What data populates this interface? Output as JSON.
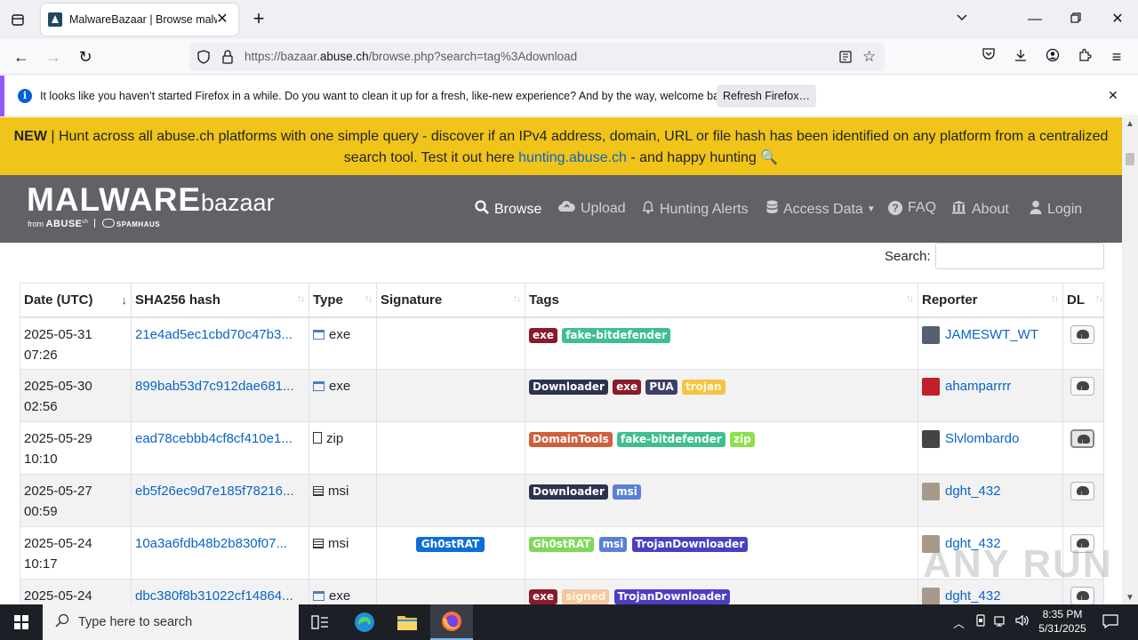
{
  "browser": {
    "tab_title": "MalwareBazaar | Browse malwa",
    "url_prefix": "https://bazaar.",
    "url_domain": "abuse.ch",
    "url_path": "/browse.php?search=tag%3Adownload"
  },
  "notification": {
    "message": "It looks like you haven’t started Firefox in a while. Do you want to clean it up for a fresh, like-new experience? And by the way, welcome back!",
    "button": "Refresh Firefox…"
  },
  "banner": {
    "new": "NEW",
    "text_1": " | Hunt across all abuse.ch platforms with one simple query - discover if an IPv4 address, domain, URL or file hash has been identified on any platform from a centralized search tool. Test it out here ",
    "link": "hunting.abuse.ch",
    "text_2": " - and happy hunting 🔍"
  },
  "site": {
    "logo_main": "MALWARE",
    "logo_sub": "bazaar",
    "logo_from": "from",
    "logo_abuse": "ABUSE",
    "logo_ch": "ch",
    "logo_spamhaus": "SPAMHAUS",
    "menu": {
      "browse": "Browse",
      "upload": "Upload",
      "hunting": "Hunting Alerts",
      "access": "Access Data",
      "faq": "FAQ",
      "about": "About",
      "login": "Login"
    },
    "search_label": "Search:"
  },
  "table": {
    "headers": {
      "date": "Date (UTC)",
      "hash": "SHA256 hash",
      "type": "Type",
      "signature": "Signature",
      "tags": "Tags",
      "reporter": "Reporter",
      "dl": "DL"
    },
    "rows": [
      {
        "date": "2025-05-31",
        "time": "07:26",
        "hash": "21e4ad5ec1cbd70c47b3...",
        "type": "exe",
        "signature": "",
        "tags": [
          {
            "t": "exe",
            "c": "#8b1a2b"
          },
          {
            "t": "fake-bitdefender",
            "c": "#3fbf8f"
          }
        ],
        "reporter": "JAMESWT_WT"
      },
      {
        "date": "2025-05-30",
        "time": "02:56",
        "hash": "899bab53d7c912dae681...",
        "type": "exe",
        "signature": "",
        "tags": [
          {
            "t": "Downloader",
            "c": "#2b3350"
          },
          {
            "t": "exe",
            "c": "#8b1a2b"
          },
          {
            "t": "PUA",
            "c": "#3d3f66"
          },
          {
            "t": "trojan",
            "c": "#f5c542"
          }
        ],
        "reporter": "ahamparrrr"
      },
      {
        "date": "2025-05-29",
        "time": "10:10",
        "hash": "ead78cebbb4cf8cf410e1...",
        "type": "zip",
        "signature": "",
        "tags": [
          {
            "t": "DomainTools",
            "c": "#d25f3b"
          },
          {
            "t": "fake-bitdefender",
            "c": "#3fbf8f"
          },
          {
            "t": "zip",
            "c": "#8ee04a"
          }
        ],
        "reporter": "Slvlombardo"
      },
      {
        "date": "2025-05-27",
        "time": "00:59",
        "hash": "eb5f26ec9d7e185f78216...",
        "type": "msi",
        "signature": "",
        "tags": [
          {
            "t": "Downloader",
            "c": "#2b3350"
          },
          {
            "t": "msi",
            "c": "#5a7fd6"
          }
        ],
        "reporter": "dght_432"
      },
      {
        "date": "2025-05-24",
        "time": "10:17",
        "hash": "10a3a6fdb48b2b830f07...",
        "type": "msi",
        "signature": "Gh0stRAT",
        "tags": [
          {
            "t": "Gh0stRAT",
            "c": "#7ed957"
          },
          {
            "t": "msi",
            "c": "#5a7fd6"
          },
          {
            "t": "TrojanDownloader",
            "c": "#4b3fc4"
          }
        ],
        "reporter": "dght_432"
      },
      {
        "date": "2025-05-24",
        "time": "",
        "hash": "dbc380f8b31022cf14864...",
        "type": "exe",
        "signature": "",
        "tags": [
          {
            "t": "exe",
            "c": "#8b1a2b"
          },
          {
            "t": "signed",
            "c": "#f5c6a0"
          },
          {
            "t": "TrojanDownloader",
            "c": "#4b3fc4"
          }
        ],
        "reporter": "dght_432"
      }
    ]
  },
  "watermark": "ANY RUN",
  "taskbar": {
    "search_placeholder": "Type here to search",
    "time": "8:35 PM",
    "date": "5/31/2025"
  }
}
